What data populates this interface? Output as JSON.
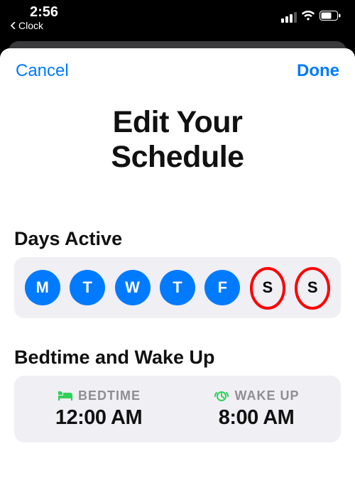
{
  "status": {
    "time": "2:56",
    "back_app": "Clock"
  },
  "nav": {
    "cancel": "Cancel",
    "done": "Done"
  },
  "title_line1": "Edit Your",
  "title_line2": "Schedule",
  "sections": {
    "days_label": "Days Active",
    "times_label": "Bedtime and Wake Up"
  },
  "days": {
    "items": [
      {
        "label": "M",
        "active": true,
        "highlight": false
      },
      {
        "label": "T",
        "active": true,
        "highlight": false
      },
      {
        "label": "W",
        "active": true,
        "highlight": false
      },
      {
        "label": "T",
        "active": true,
        "highlight": false
      },
      {
        "label": "F",
        "active": true,
        "highlight": false
      },
      {
        "label": "S",
        "active": false,
        "highlight": true
      },
      {
        "label": "S",
        "active": false,
        "highlight": true
      }
    ]
  },
  "times": {
    "bedtime_label": "BEDTIME",
    "bedtime_value": "12:00 AM",
    "wakeup_label": "WAKE UP",
    "wakeup_value": "8:00 AM"
  },
  "colors": {
    "accent": "#007aff",
    "green": "#30d158",
    "highlight_ring": "#ff0000"
  }
}
